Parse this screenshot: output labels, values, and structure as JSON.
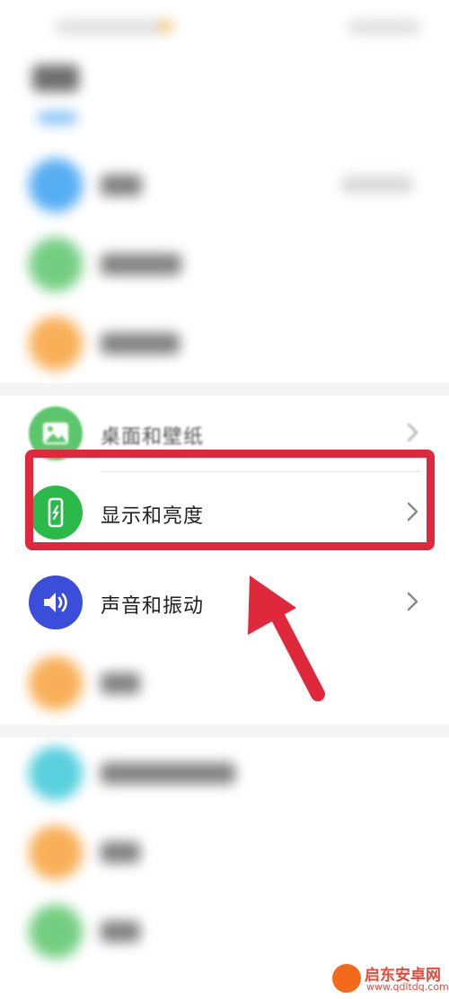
{
  "settings_list": {
    "items": [
      {
        "label": "桌面和壁纸",
        "icon": "wallpaper-icon",
        "color": "#5cc66c"
      },
      {
        "label": "显示和亮度",
        "icon": "display-brightness-icon",
        "color": "#2bba4a"
      },
      {
        "label": "声音和振动",
        "icon": "sound-icon",
        "color": "#3b4ed9"
      }
    ]
  },
  "colors": {
    "highlight": "#e0283c",
    "blue_icon": "#3aa0f0",
    "green_icon": "#5cc66c",
    "orange_icon": "#f7a23b",
    "teal_icon": "#3cc8d8"
  },
  "watermark": {
    "name": "启东安卓网",
    "url": "www.qdltdq.com"
  }
}
